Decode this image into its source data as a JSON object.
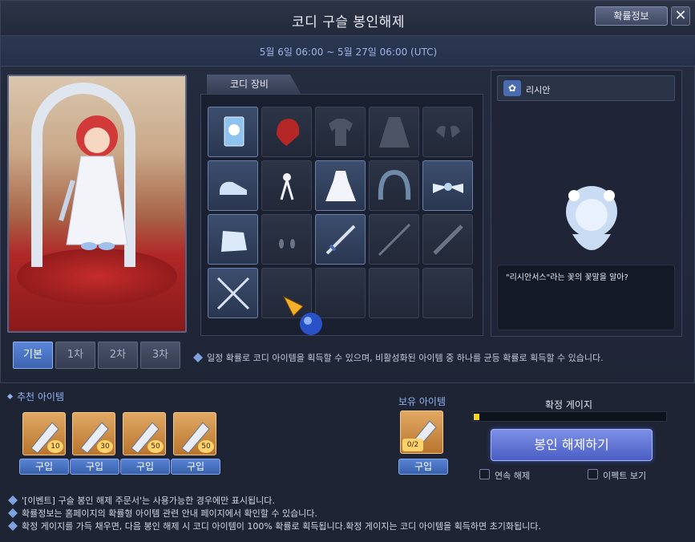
{
  "window": {
    "title": "코디 구슬 봉인해제",
    "prob_button": "확률정보",
    "close_glyph": "✕",
    "period": "5월 6일 06:00 ~ 5월 27일 06:00 (UTC)"
  },
  "equipment": {
    "tab_label": "코디 장비",
    "grade_tabs": [
      "기본",
      "1차",
      "2차",
      "3차"
    ],
    "active_grade": "기본",
    "info": "일정 확률로 코디 아이템을 획득할 수 있으며, 비활성화된 아이템 중 하나를 균등 확률로 획득할 수 있습니다.",
    "slots": [
      "card",
      "hair",
      "top",
      "overall",
      "gloves",
      "shoes",
      "ribbon",
      "dress",
      "wreath",
      "bow",
      "cape",
      "earring",
      "sword",
      "spear",
      "blade",
      "crossed-swords",
      "empty",
      "empty",
      "empty",
      "empty"
    ]
  },
  "pet": {
    "name": "리시안",
    "quote": "\"리시안서스\"라는 꽃의 꽃말을 알아?"
  },
  "recommended": {
    "title": "추천 아이템",
    "items": [
      {
        "count": "10",
        "buy": "구입"
      },
      {
        "count": "30",
        "buy": "구입"
      },
      {
        "count": "50",
        "buy": "구입"
      },
      {
        "count": "50",
        "buy": "구입"
      }
    ]
  },
  "owned": {
    "title": "보유 아이템",
    "count": "0/2",
    "buy": "구입"
  },
  "gauge": {
    "title": "확정 게이지",
    "fill_fraction": 0.03,
    "color": "#f4d22a"
  },
  "actions": {
    "unseal": "봉인 해제하기",
    "continuous": "연속 해제",
    "effect": "이펙트 보기"
  },
  "notes": [
    "'[이벤트] 구슬 봉인 해제 주문서'는 사용가능한 경우에만 표시됩니다.",
    "확률정보는 홈페이지의 확률형 아이템 관련 안내 페이지에서 확인할 수 있습니다.",
    "확정 게이지를 가득 채우면, 다음 봉인 해제 시 코디 아이템이 100% 확률로 획득됩니다.확정 게이지는 코디 아이템을 획득하면 초기화됩니다."
  ]
}
